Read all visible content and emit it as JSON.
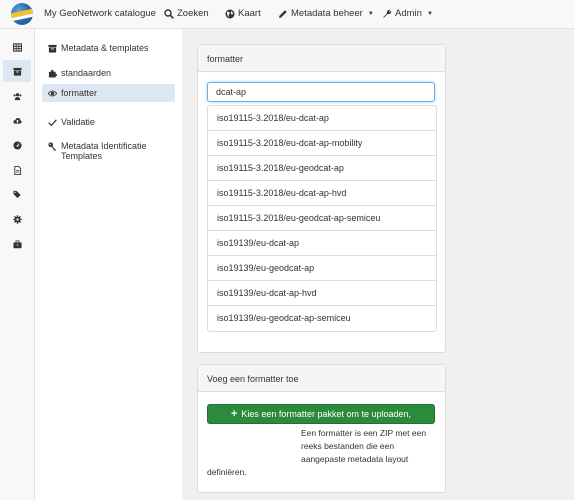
{
  "header": {
    "brand": "My GeoNetwork catalogue",
    "nav": [
      {
        "label": "Zoeken",
        "icon": "search-icon"
      },
      {
        "label": "Kaart",
        "icon": "globe-icon"
      },
      {
        "label": "Metadata beheer",
        "icon": "pencil-icon"
      },
      {
        "label": "Admin",
        "icon": "wrench-icon"
      }
    ]
  },
  "iconbar": {
    "items": [
      "table-icon",
      "archive-icon",
      "users-icon",
      "cloud-upload-icon",
      "dashboard-icon",
      "file-icon",
      "tags-icon",
      "cog-icon",
      "briefcase-icon"
    ],
    "active_index": 1
  },
  "sidenav": {
    "items": [
      {
        "label": "Metadata & templates",
        "icon": "archive-icon"
      },
      {
        "label": "standaarden",
        "icon": "puzzle-icon"
      },
      {
        "label": "formatter",
        "icon": "eye-icon",
        "active": true
      },
      {
        "label": "Validatie",
        "icon": "check-icon"
      },
      {
        "label": "Metadata Identificatie Templates",
        "icon": "key-icon"
      }
    ]
  },
  "formatter_panel": {
    "title": "formatter",
    "search_value": "dcat-ap",
    "results": [
      "iso19115-3.2018/eu-dcat-ap",
      "iso19115-3.2018/eu-dcat-ap-mobility",
      "iso19115-3.2018/eu-geodcat-ap",
      "iso19115-3.2018/eu-dcat-ap-hvd",
      "iso19115-3.2018/eu-geodcat-ap-semiceu",
      "iso19139/eu-dcat-ap",
      "iso19139/eu-geodcat-ap",
      "iso19139/eu-dcat-ap-hvd",
      "iso19139/eu-geodcat-ap-semiceu"
    ]
  },
  "add_panel": {
    "title": "Voeg een formatter toe",
    "upload_button": "Kies een formatter pakket om te uploaden,",
    "help_line1": "Een formatter is een ZIP met een",
    "help_line2": "reeks bestanden die een",
    "help_line3": "aangepaste metadata layout",
    "help_line4": "definiëren."
  },
  "colors": {
    "accent": "#66afe9",
    "success": "#2c8a3c",
    "active_bg": "#dde7f1"
  }
}
